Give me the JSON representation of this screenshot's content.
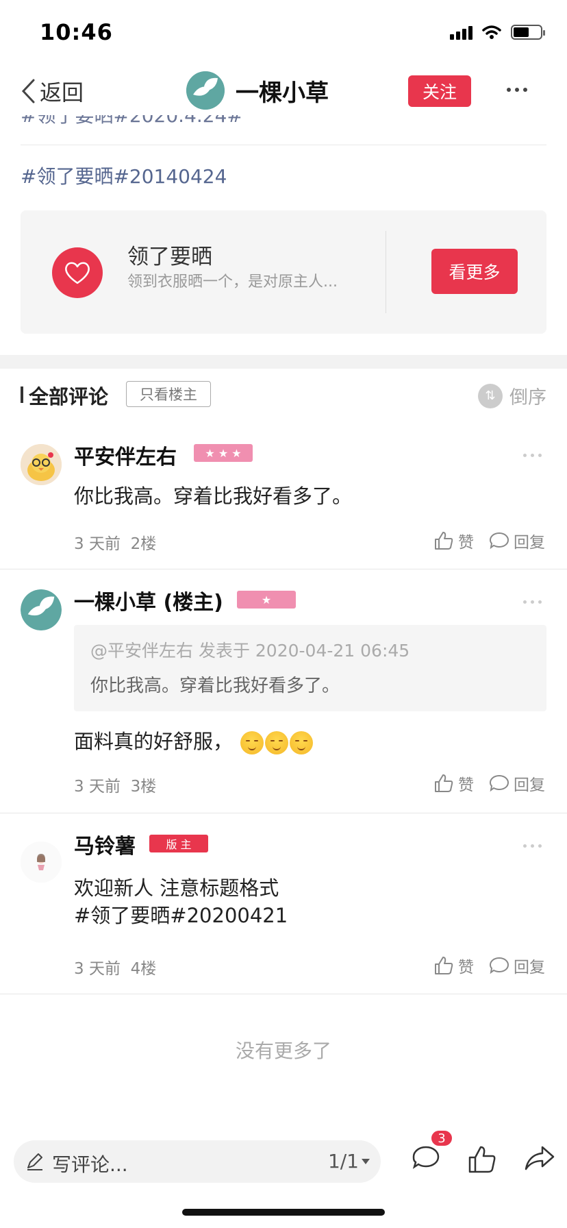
{
  "status_bar": {
    "time": "10:46"
  },
  "nav": {
    "back_label": "返回",
    "title": "一棵小草",
    "follow_label": "关注"
  },
  "post": {
    "cut_text": "#领了要晒#2020.4.24#",
    "tag_text": "#领了要晒#20140424"
  },
  "topic": {
    "title": "领了要晒",
    "description": "领到衣服晒一个，是对原主人...",
    "see_more_label": "看更多",
    "accent_color": "#e8364d"
  },
  "comments_header": {
    "title": "全部评论",
    "only_owner_label": "只看楼主",
    "sort_label": "倒序"
  },
  "comments": [
    {
      "author": "平安伴左右",
      "badge": "★ ★ ★",
      "text": "你比我高。穿着比我好看多了。",
      "time": "3 天前",
      "floor": "2楼",
      "like_label": "赞",
      "reply_label": "回复"
    },
    {
      "author": "一棵小草 (楼主)",
      "badge": "★",
      "quote_head": "@平安伴左右 发表于 2020-04-21 06:45",
      "quote_body": "你比我高。穿着比我好看多了。",
      "text": "面料真的好舒服，",
      "time": "3 天前",
      "floor": "3楼",
      "like_label": "赞",
      "reply_label": "回复"
    },
    {
      "author": "马铃薯",
      "badge": "版 主",
      "text_line1": "欢迎新人 注意标题格式",
      "text_line2": "#领了要晒#20200421",
      "time": "3 天前",
      "floor": "4楼",
      "like_label": "赞",
      "reply_label": "回复"
    }
  ],
  "no_more_label": "没有更多了",
  "bottom_bar": {
    "input_placeholder": "写评论...",
    "page_indicator": "1/1",
    "comment_count": "3"
  },
  "colors": {
    "brand_red": "#e8364d",
    "badge_pink": "#f08fb0",
    "tag_blue": "#55668f"
  }
}
